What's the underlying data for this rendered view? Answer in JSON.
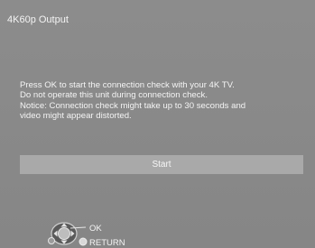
{
  "screen": {
    "title": "4K60p Output",
    "message": [
      "Press OK to start the connection check with your 4K TV.",
      "Do not operate this unit during connection check.",
      "Notice: Connection check might take up to 30 seconds and",
      "video might appear distorted."
    ],
    "start_label": "Start"
  },
  "guide": {
    "ok_label": "OK",
    "return_label": "RETURN",
    "icons": [
      "remote-dpad-icon",
      "return-button-icon"
    ]
  },
  "colors": {
    "background": "#8a8a8a",
    "button": "#a9a9a9",
    "text": "#f4f4f4"
  }
}
